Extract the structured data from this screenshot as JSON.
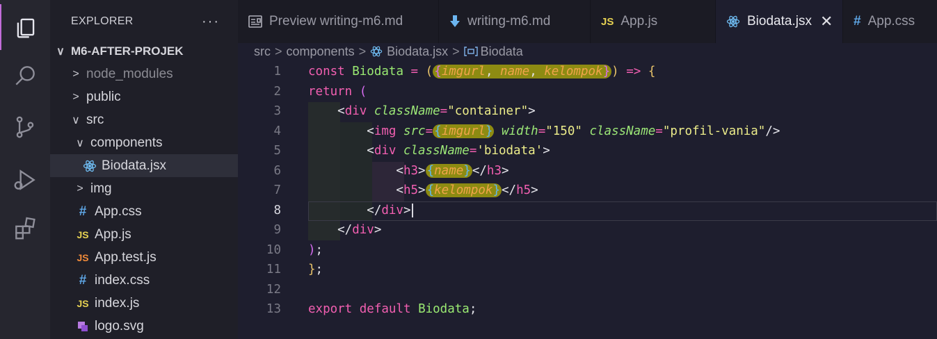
{
  "activity_bar": {
    "items": [
      {
        "name": "explorer-icon",
        "active": true
      },
      {
        "name": "search-icon",
        "active": false
      },
      {
        "name": "source-control-icon",
        "active": false
      },
      {
        "name": "run-debug-icon",
        "active": false
      },
      {
        "name": "extensions-icon",
        "active": false
      }
    ],
    "accent": "#c26cd9"
  },
  "sidebar": {
    "title": "EXPLORER",
    "more": "···",
    "root": "M6-AFTER-PROJEK",
    "items": [
      {
        "label": "node_modules",
        "type": "folder",
        "expanded": false,
        "depth": 1,
        "dim": true
      },
      {
        "label": "public",
        "type": "folder",
        "expanded": false,
        "depth": 1
      },
      {
        "label": "src",
        "type": "folder",
        "expanded": true,
        "depth": 1
      },
      {
        "label": "components",
        "type": "folder",
        "expanded": true,
        "depth": 2
      },
      {
        "label": "Biodata.jsx",
        "type": "react",
        "depth": 3,
        "selected": true
      },
      {
        "label": "img",
        "type": "folder",
        "expanded": false,
        "depth": 2
      },
      {
        "label": "App.css",
        "type": "css",
        "depth": 2
      },
      {
        "label": "App.js",
        "type": "js",
        "depth": 2
      },
      {
        "label": "App.test.js",
        "type": "js-test",
        "depth": 2
      },
      {
        "label": "index.css",
        "type": "css",
        "depth": 2
      },
      {
        "label": "index.js",
        "type": "js",
        "depth": 2
      },
      {
        "label": "logo.svg",
        "type": "svg",
        "depth": 2
      }
    ]
  },
  "tabs": [
    {
      "label": "Preview writing-m6.md",
      "icon": "preview-icon",
      "active": false
    },
    {
      "label": "writing-m6.md",
      "icon": "markdown-icon",
      "active": false
    },
    {
      "label": "App.js",
      "icon": "js-icon",
      "active": false
    },
    {
      "label": "Biodata.jsx",
      "icon": "react-icon",
      "active": true,
      "close": "✕"
    },
    {
      "label": "App.css",
      "icon": "css-icon",
      "active": false
    }
  ],
  "breadcrumb": {
    "parts": [
      "src",
      "components",
      "Biodata.jsx",
      "Biodata"
    ]
  },
  "editor": {
    "current_line": 8,
    "lines": [
      {
        "n": "1",
        "code": "const Biodata = ({imgurl, name, kelompok}) => {"
      },
      {
        "n": "2",
        "code": "return ("
      },
      {
        "n": "3",
        "code": "<div className=\"container\">"
      },
      {
        "n": "4",
        "code": "<img src={imgurl} width=\"150\" className=\"profil-vania\"/>"
      },
      {
        "n": "5",
        "code": "<div className='biodata'>"
      },
      {
        "n": "6",
        "code": "<h3>{name}</h3>"
      },
      {
        "n": "7",
        "code": "<h5>{kelompok}</h5>"
      },
      {
        "n": "8",
        "code": "</div>"
      },
      {
        "n": "9",
        "code": "</div>"
      },
      {
        "n": "10",
        "code": ");"
      },
      {
        "n": "11",
        "code": "};"
      },
      {
        "n": "12",
        "code": ""
      },
      {
        "n": "13",
        "code": "export default Biodata;"
      }
    ]
  },
  "glyphs": {
    "js": "JS",
    "css": "#",
    "chev_right": ">",
    "chev_down": "∨"
  }
}
